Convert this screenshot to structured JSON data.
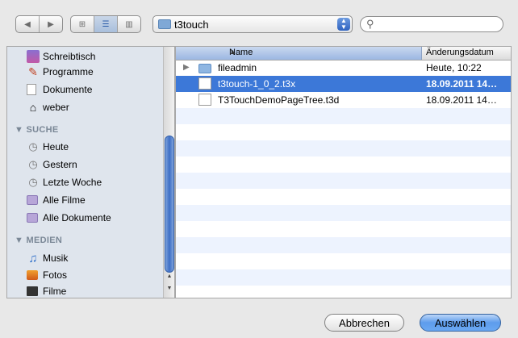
{
  "toolbar": {
    "back_icon": "◀",
    "forward_icon": "▶",
    "view_icons": [
      "⊞",
      "☰",
      "▥"
    ],
    "location": "t3touch",
    "search_placeholder": ""
  },
  "sidebar": {
    "places": [
      {
        "label": "Schreibtisch",
        "icon": "desktop-icon"
      },
      {
        "label": "Programme",
        "icon": "applications-icon"
      },
      {
        "label": "Dokumente",
        "icon": "documents-icon"
      },
      {
        "label": "weber",
        "icon": "home-icon"
      }
    ],
    "search_header": "▼ SUCHE",
    "searches": [
      {
        "label": "Heute",
        "icon": "clock-icon"
      },
      {
        "label": "Gestern",
        "icon": "clock-icon"
      },
      {
        "label": "Letzte Woche",
        "icon": "clock-icon"
      },
      {
        "label": "Alle Filme",
        "icon": "smart-folder-icon"
      },
      {
        "label": "Alle Dokumente",
        "icon": "smart-folder-icon"
      }
    ],
    "media_header": "▼ MEDIEN",
    "media": [
      {
        "label": "Musik",
        "icon": "music-icon"
      },
      {
        "label": "Fotos",
        "icon": "photos-icon"
      },
      {
        "label": "Filme",
        "icon": "movies-icon"
      }
    ]
  },
  "columns": {
    "name": "Name",
    "date": "Änderungsdatum"
  },
  "files": [
    {
      "name": "fileadmin",
      "date": "Heute, 10:22",
      "type": "folder"
    },
    {
      "name": "t3touch-1_0_2.t3x",
      "date": "18.09.2011 14…",
      "type": "file"
    },
    {
      "name": "T3TouchDemoPageTree.t3d",
      "date": "18.09.2011 14…",
      "type": "file"
    }
  ],
  "buttons": {
    "cancel": "Abbrechen",
    "ok": "Auswählen"
  },
  "colors": {
    "selection": "#3c78d8",
    "stripe": "#edf3fe",
    "sidebar_bg": "#dfe5ed"
  }
}
